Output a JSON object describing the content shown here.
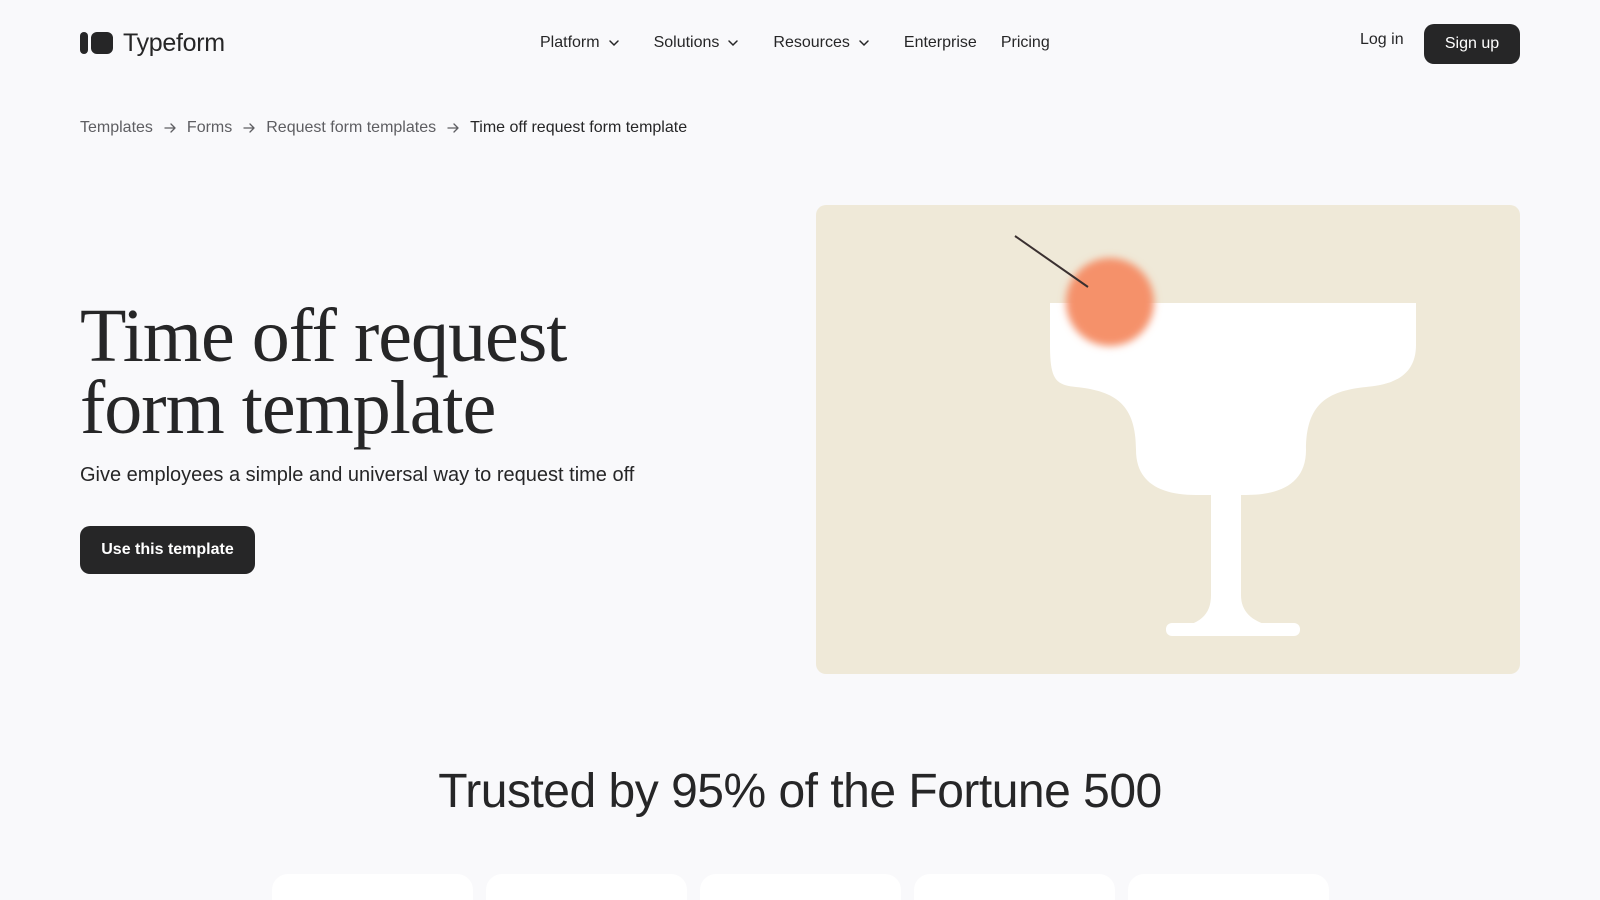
{
  "header": {
    "brand": "Typeform",
    "nav": [
      {
        "label": "Platform",
        "dropdown": true
      },
      {
        "label": "Solutions",
        "dropdown": true
      },
      {
        "label": "Resources",
        "dropdown": true
      },
      {
        "label": "Enterprise",
        "dropdown": false
      },
      {
        "label": "Pricing",
        "dropdown": false
      }
    ],
    "login_label": "Log in",
    "signup_label": "Sign up"
  },
  "breadcrumb": {
    "items": [
      "Templates",
      "Forms",
      "Request form templates",
      "Time off request form template"
    ]
  },
  "hero": {
    "title_line1": "Time off request",
    "title_line2": "form template",
    "subtitle": "Give employees a simple and universal way to request time off",
    "cta_label": "Use this template",
    "illustration_icon": "cocktail-glass-illustration"
  },
  "trusted": {
    "heading": "Trusted by 95% of the Fortune 500"
  },
  "colors": {
    "background": "#f9f9fb",
    "text": "#262627",
    "illustration_bg": "#efe9d8",
    "cherry": "#f5916a"
  }
}
